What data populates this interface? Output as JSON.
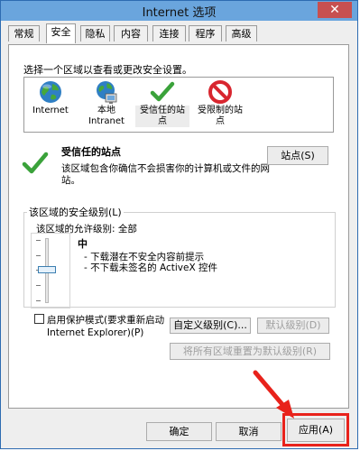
{
  "window": {
    "title": "Internet 选项",
    "close_glyph": "✕"
  },
  "tabs": [
    {
      "label": "常规"
    },
    {
      "label": "安全"
    },
    {
      "label": "隐私"
    },
    {
      "label": "内容"
    },
    {
      "label": "连接"
    },
    {
      "label": "程序"
    },
    {
      "label": "高级"
    }
  ],
  "active_tab": "安全",
  "security": {
    "instruction": "选择一个区域以查看或更改安全设置。",
    "zones": [
      {
        "label_line1": "Internet",
        "label_line2": "",
        "icon": "globe-icon"
      },
      {
        "label_line1": "本地",
        "label_line2": "Intranet",
        "icon": "local-intranet-icon"
      },
      {
        "label_line1": "受信任的站",
        "label_line2": "点",
        "icon": "trusted-check-icon"
      },
      {
        "label_line1": "受限制的站",
        "label_line2": "点",
        "icon": "restricted-icon"
      }
    ],
    "selected_zone": "受信任的站点",
    "detail": {
      "title": "受信任的站点",
      "description": "该区域包含你确信不会损害你的计算机或文件的网站。",
      "sites_button": "站点(S)"
    },
    "level_group": {
      "legend": "该区域的安全级别(L)",
      "allowed_label": "该区域的允许级别: 全部",
      "level_name": "中",
      "bullets": [
        "- 下载潜在不安全内容前提示",
        "- 不下载未签名的 ActiveX 控件"
      ]
    },
    "protected_mode": {
      "label_line1": "启用保护模式(要求重新启动",
      "label_line2": "Internet Explorer)(P)",
      "checked": false
    },
    "custom_level_button": "自定义级别(C)...",
    "default_level_button": "默认级别(D)",
    "reset_all_button": "将所有区域重置为默认级别(R)"
  },
  "footer": {
    "ok_button": "确定",
    "cancel_button": "取消",
    "apply_button": "应用(A)"
  },
  "colors": {
    "titlebar": "#6aa5dd",
    "close": "#c75050",
    "annotation": "#e8221b",
    "check_green": "#3aa23a"
  }
}
